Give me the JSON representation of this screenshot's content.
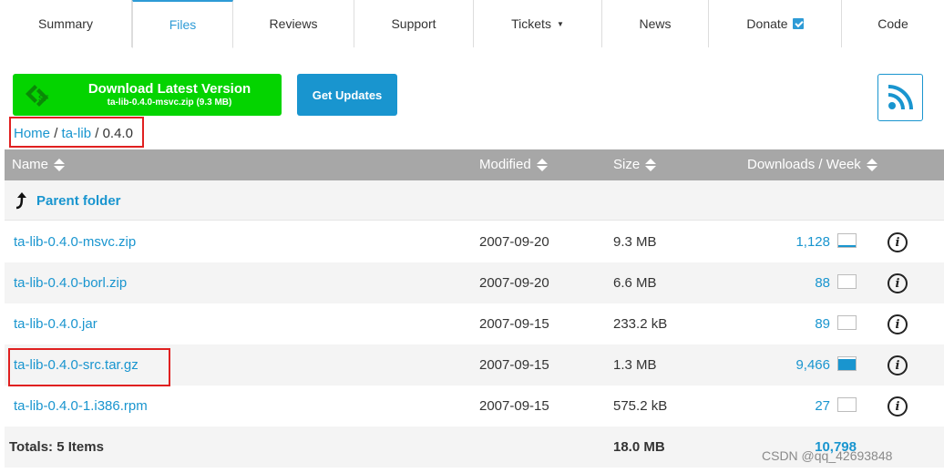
{
  "tabs": [
    {
      "label": "Summary",
      "active": false
    },
    {
      "label": "Files",
      "active": true
    },
    {
      "label": "Reviews",
      "active": false
    },
    {
      "label": "Support",
      "active": false
    },
    {
      "label": "Tickets",
      "active": false,
      "has_dropdown": true
    },
    {
      "label": "News",
      "active": false
    },
    {
      "label": "Donate",
      "active": false,
      "icon": "external-link-icon"
    },
    {
      "label": "Code",
      "active": false
    }
  ],
  "download_button": {
    "title": "Download Latest Version",
    "subtitle": "ta-lib-0.4.0-msvc.zip (9.3 MB)",
    "color": "#04d400"
  },
  "updates_button": {
    "label": "Get Updates",
    "color": "#1995cf"
  },
  "rss": {
    "icon": "rss-icon"
  },
  "breadcrumb": {
    "home": "Home",
    "project": "ta-lib",
    "current": "0.4.0",
    "separator": "/"
  },
  "table": {
    "headers": {
      "name": "Name",
      "modified": "Modified",
      "size": "Size",
      "downloads": "Downloads / Week"
    },
    "parent_folder": "Parent folder",
    "rows": [
      {
        "name": "ta-lib-0.4.0-msvc.zip",
        "modified": "2007-09-20",
        "size": "9.3 MB",
        "downloads": "1,128",
        "week_level": 0.12
      },
      {
        "name": "ta-lib-0.4.0-borl.zip",
        "modified": "2007-09-20",
        "size": "6.6 MB",
        "downloads": "88",
        "week_level": 0.0
      },
      {
        "name": "ta-lib-0.4.0.jar",
        "modified": "2007-09-15",
        "size": "233.2 kB",
        "downloads": "89",
        "week_level": 0.0
      },
      {
        "name": "ta-lib-0.4.0-src.tar.gz",
        "modified": "2007-09-15",
        "size": "1.3 MB",
        "downloads": "9,466",
        "week_level": 0.85
      },
      {
        "name": "ta-lib-0.4.0-1.i386.rpm",
        "modified": "2007-09-15",
        "size": "575.2 kB",
        "downloads": "27",
        "week_level": 0.0
      }
    ],
    "totals": {
      "label": "Totals: 5 Items",
      "size": "18.0 MB",
      "downloads": "10,798"
    }
  },
  "watermark": "CSDN @qq_42693848",
  "colors": {
    "accent": "#1995cf",
    "highlight": "#e02020",
    "header_bg": "#a7a7a7"
  }
}
